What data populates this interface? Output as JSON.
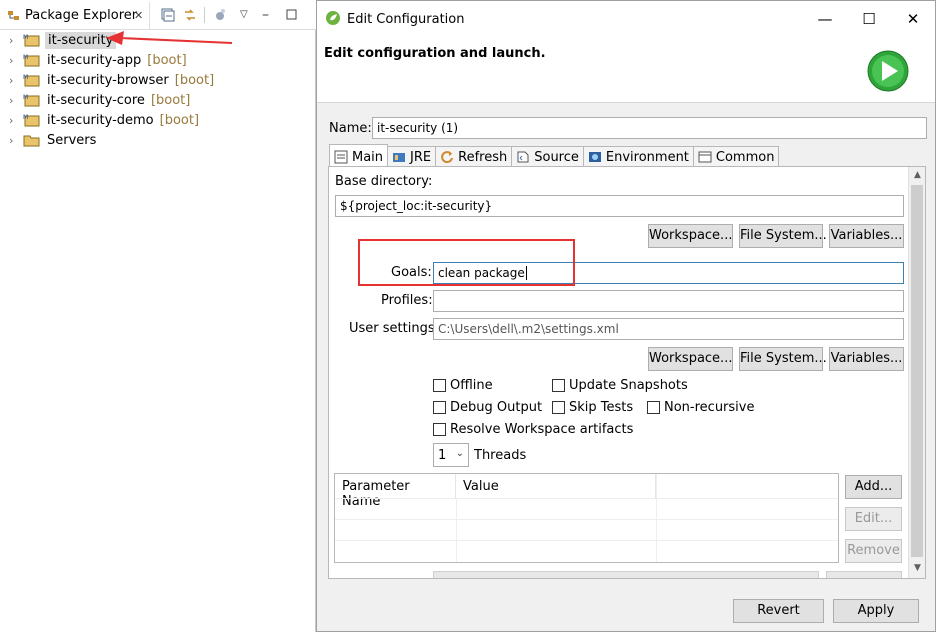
{
  "package_explorer": {
    "tab_label": "Package Explorer",
    "tree": [
      {
        "label": "it-security",
        "suffix": "",
        "selected": true
      },
      {
        "label": "it-security-app",
        "suffix": "[boot]",
        "selected": false
      },
      {
        "label": "it-security-browser",
        "suffix": "[boot]",
        "selected": false
      },
      {
        "label": "it-security-core",
        "suffix": "[boot]",
        "selected": false
      },
      {
        "label": "it-security-demo",
        "suffix": "[boot]",
        "selected": false
      },
      {
        "label": "Servers",
        "suffix": "",
        "selected": false
      }
    ]
  },
  "dialog": {
    "title": "Edit Configuration",
    "header": "Edit configuration and launch.",
    "name_label": "Name:",
    "name_value": "it-security (1)",
    "tabs": [
      "Main",
      "JRE",
      "Refresh",
      "Source",
      "Environment",
      "Common"
    ],
    "base_dir_label": "Base directory:",
    "base_dir_value": "${project_loc:it-security}",
    "workspace_button": "Workspace...",
    "filesystem_button": "File System...",
    "variables_button": "Variables...",
    "goals_label": "Goals:",
    "goals_value": "clean package",
    "profiles_label": "Profiles:",
    "profiles_value": "",
    "user_settings_label": "User settings:",
    "user_settings_value": "C:\\Users\\dell\\.m2\\settings.xml",
    "checkboxes": {
      "offline": "Offline",
      "update_snapshots": "Update Snapshots",
      "debug_output": "Debug Output",
      "skip_tests": "Skip Tests",
      "non_recursive": "Non-recursive",
      "resolve_workspace": "Resolve Workspace artifacts"
    },
    "threads_value": "1",
    "threads_label": "Threads",
    "params_headers": [
      "Parameter Name",
      "Value"
    ],
    "add_button": "Add...",
    "edit_button": "Edit...",
    "remove_button": "Remove",
    "revert_button": "Revert",
    "apply_button": "Apply"
  },
  "colors": {
    "annotation_red": "#e53333",
    "run_green": "#2fa43a"
  }
}
